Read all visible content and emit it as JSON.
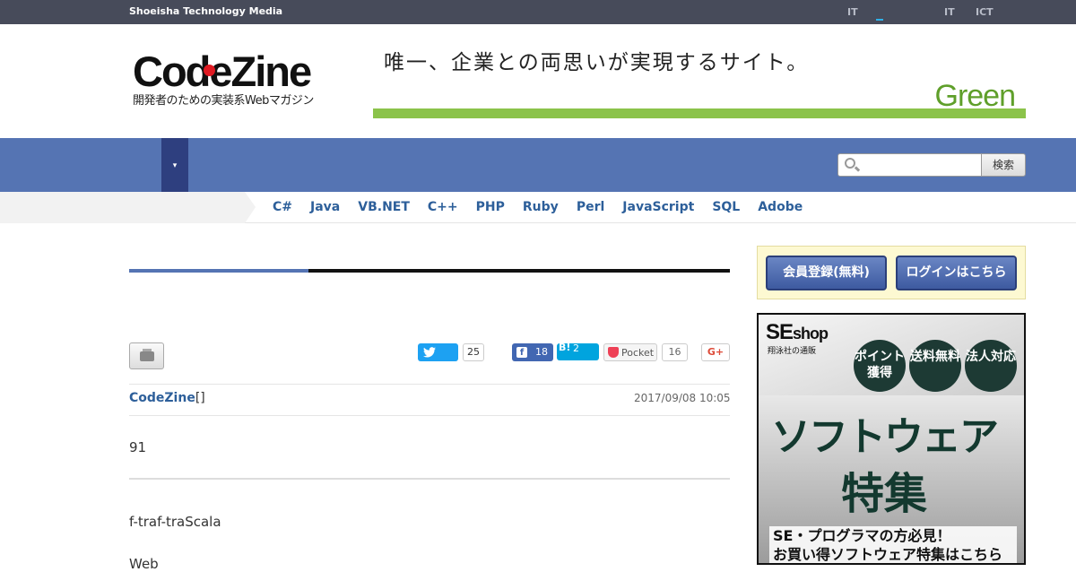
{
  "topbar": {
    "brand": "Shoeisha Technology Media",
    "links": [
      "IT",
      "IT",
      "ICT"
    ]
  },
  "logo": {
    "name": "CodeZine",
    "tagline": "開発者のための実装系Webマガジン"
  },
  "banner": {
    "copy": "唯一、企業との両思いが実現するサイト。",
    "brand": "Green"
  },
  "nav": {
    "dropdown_glyph": "▾",
    "search_placeholder": "",
    "search_button": "検索"
  },
  "languages": [
    "C#",
    "Java",
    "VB.NET",
    "C++",
    "PHP",
    "Ruby",
    "Perl",
    "JavaScript",
    "SQL",
    "Adobe"
  ],
  "article": {
    "share": {
      "twitter_count": "25",
      "facebook_count": "18",
      "hatena_label": "B!",
      "hatena_count": "2",
      "pocket_label": "Pocket",
      "pocket_count": "16",
      "gplus_label": "G+"
    },
    "author": "CodeZine",
    "author_suffix": "[]",
    "date": "2017/09/08 10:05",
    "lines": [
      "91",
      "f-traf-traScala",
      "Web"
    ]
  },
  "sidebar": {
    "register_button": "会員登録(無料)",
    "login_button": "ログインはこちら",
    "ad": {
      "logo_main": "SE",
      "logo_small": "shop",
      "sub": "翔泳社の通販",
      "badges": [
        "ポイント獲得",
        "送料無料",
        "法人対応"
      ],
      "headline1": "ソフトウェア",
      "headline2": "特集",
      "cta1": "SE・プログラマの方必見！",
      "cta2": "お買い得ソフトウェア特集はこちら"
    }
  },
  "colors": {
    "topbar": "#474b5a",
    "nav": "#5574b3",
    "link": "#2d5f9a",
    "banner_bar": "#8bc34a"
  }
}
